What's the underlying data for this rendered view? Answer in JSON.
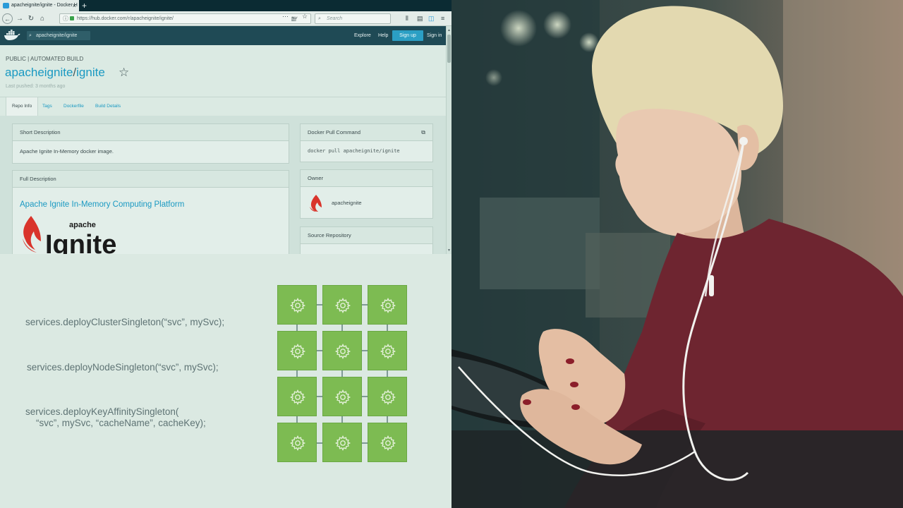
{
  "browser": {
    "tab_title": "apacheignite/ignite - Docker H",
    "tab_close": "×",
    "new_tab": "+",
    "nav": {
      "back": "←",
      "forward": "→",
      "reload": "↻",
      "home": "⌂"
    },
    "url": "https://hub.docker.com/r/apacheignite/ignite/",
    "url_actions": {
      "more": "···",
      "pocket": "◡",
      "bookmark": "☆"
    },
    "search_placeholder": "Search",
    "toolbar_icons": {
      "library": "⫴",
      "sidebar": "▤",
      "pocket": "◫",
      "menu": "≡"
    }
  },
  "docker_header": {
    "search_value": "apacheignite/ignite",
    "links": {
      "explore": "Explore",
      "help": "Help",
      "signup": "Sign up",
      "signin": "Sign in"
    }
  },
  "repo": {
    "kind": "PUBLIC | AUTOMATED BUILD",
    "namespace": "apacheignite",
    "slash": "/",
    "name": "ignite",
    "star": "☆",
    "last_pushed": "Last pushed: 3 months ago",
    "tabs": [
      "Repo Info",
      "Tags",
      "Dockerfile",
      "Build Details"
    ]
  },
  "panels": {
    "short_description": {
      "title": "Short Description",
      "body": "Apache Ignite In-Memory docker image."
    },
    "full_description": {
      "title": "Full Description",
      "heading": "Apache Ignite In-Memory Computing Platform",
      "logo_top": "apache",
      "logo_main": "Ignite"
    },
    "pull_command": {
      "title": "Docker Pull Command",
      "command": "docker pull apacheignite/ignite"
    },
    "owner": {
      "title": "Owner",
      "name": "apacheignite"
    },
    "source_repo": {
      "title": "Source Repository"
    }
  },
  "code_lines": [
    "services.deployClusterSingleton(“svc”, mySvc);",
    "services.deployNodeSingleton(“svc”, mySvc);",
    "services.deployKeyAffinitySingleton(",
    "    “svc”, mySvc, “cacheName”, cacheKey);"
  ],
  "colors": {
    "docker_blue": "#1a99c2",
    "header_bg": "#1f4a55",
    "grid_green": "#7dbb52",
    "ignite_red": "#d9342b"
  }
}
